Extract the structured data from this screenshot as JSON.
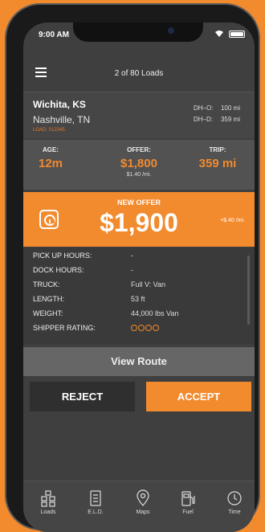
{
  "status": {
    "time": "9:00 AM"
  },
  "nav": {
    "title": "2 of 80 Loads"
  },
  "load": {
    "origin": "Wichita, KS",
    "destination": "Nashville, TN",
    "load_id": "LOAD: 012345",
    "dh_o_label": "DH–O:",
    "dh_o_value": "100 mi",
    "dh_d_label": "DH–D:",
    "dh_d_value": "359 mi"
  },
  "stats": {
    "age_label": "AGE:",
    "age_value": "12m",
    "offer_label": "OFFER:",
    "offer_value": "$1,800",
    "offer_rate": "$1.40 /mi.",
    "trip_label": "TRIP:",
    "trip_value": "359 mi"
  },
  "new_offer": {
    "label": "NEW OFFER",
    "value": "$1,900",
    "rate_change": "+$.40 /mi."
  },
  "details": [
    {
      "label": "PICK UP HOURS:",
      "value": "-"
    },
    {
      "label": "DOCK HOURS:",
      "value": "-"
    },
    {
      "label": "TRUCK:",
      "value": "Full V: Van"
    },
    {
      "label": "LENGTH:",
      "value": "53 ft"
    },
    {
      "label": "WEIGHT:",
      "value": "44,000 lbs Van"
    },
    {
      "label": "SHIPPER RATING:",
      "value": ""
    }
  ],
  "shipper_rating": {
    "filled": 4,
    "of": 4
  },
  "actions": {
    "view_route": "View Route",
    "reject": "REJECT",
    "accept": "ACCEPT"
  },
  "tabs": [
    {
      "label": "Loads",
      "icon": "loads-icon"
    },
    {
      "label": "E.L.D.",
      "icon": "eld-icon"
    },
    {
      "label": "Maps",
      "icon": "map-pin-icon"
    },
    {
      "label": "Fuel",
      "icon": "fuel-pump-icon"
    },
    {
      "label": "Time",
      "icon": "clock-icon"
    }
  ],
  "colors": {
    "accent": "#f28a2e",
    "background": "#3f3f3f"
  }
}
